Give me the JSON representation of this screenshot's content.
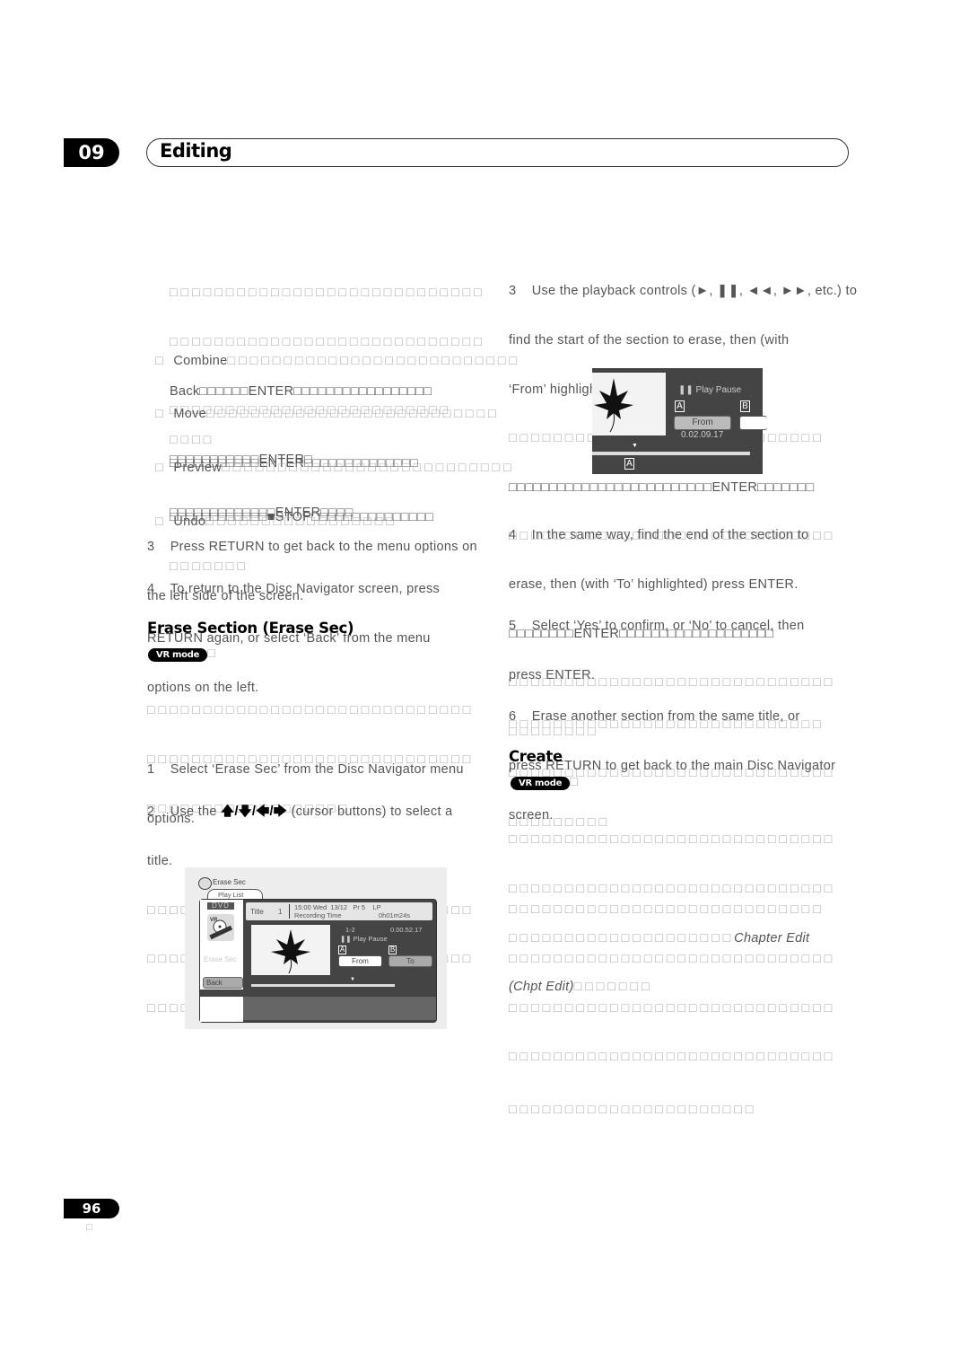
{
  "header": {
    "chapter_number": "09",
    "chapter_title": "Editing"
  },
  "left_column": {
    "intro_lines": [
      "□□□□□□□□□□□□□□□□□□□□□□□□□□□□",
      "□□□□□□□□□□□□□□□□□□□□□□□□□□□□",
      "Back□□□□□□ENTER□□□□□□□□□□□□□□□□□",
      "□□□□"
    ],
    "bullets": [
      {
        "label": "Combine",
        "lines": [
          "□□□□□□□□□□□□□□□□□□□□□□□□□□",
          "□□□□□□□□□□□□□□□□□□□□□□□□□",
          "□□□□□□□□□□□ENTER□"
        ]
      },
      {
        "label": "Move",
        "lines": [
          "□□□□□□□□□□□□□□□□□□□□□□□□□□",
          "□□□□□□□□□□□ENTER□□□□□□□□□□□□□□",
          "□□□□□□□□□□□□□ENTER□□□□"
        ]
      },
      {
        "label": "Preview",
        "lines": [
          "□□□□□□□□□□□□□□□□□□□□□□□□□□",
          "□□□□□□□□□□□□■STOP□□□□□□□□□□□□□□□",
          "□□□□□□□"
        ]
      },
      {
        "label": "Undo",
        "lines": [
          "□□□□□□□□□□□□□□□□□"
        ]
      }
    ],
    "step3": {
      "num": "3",
      "lines": [
        "Press RETURN to get back to the menu options on",
        "the left side of the screen."
      ]
    },
    "step4": {
      "num": "4",
      "lines": [
        "To return to the Disc Navigator screen, press",
        "RETURN again, or select ‘Back’ from the menu",
        "options on the left."
      ]
    },
    "erase_section": {
      "heading": "Erase Section (Erase Sec)",
      "badge": "VR mode",
      "badge_suffix": "□",
      "intro_lines": [
        "□□□□□□□□□□□□□□□□□□□□□□□□□□□□□",
        "□□□□□□□□□□□□□□□□□□□□□□□□□□□□□",
        "□□□□□□□□□□□□□□□□□□"
      ],
      "step1": {
        "num": "1",
        "lines": [
          "Select ‘Erase Sec’ from the Disc Navigator menu",
          "options."
        ]
      },
      "step2": {
        "num": "2",
        "text_before": "Use the",
        "arrows": "🡅/🡇/🡄/🡆",
        "text_after": "(cursor buttons) to select a",
        "line2": "title."
      },
      "step2_tofu": [
        "□□□□□□□□□□□□□□□□□□□□□□□□□□□□□",
        "□□□□□□□□□□□□□□□□□□□□□□□□□□□□□",
        "□□□□□□□□□□"
      ]
    }
  },
  "screen1": {
    "menu_title": "Erase Sec",
    "tab": "Play List",
    "disc_type": "DVD",
    "title_label": "Title",
    "title_number": "1",
    "datetime": "15:00 Wed  13/12   Pr 5    LP",
    "recording_time_label": "Recording Time",
    "recording_time": "0h01m24s",
    "chapter": "1-2",
    "timecode": "0.00.52.17",
    "status": "Play Pause",
    "marker_a": "A",
    "marker_b": "B",
    "from_button": "From",
    "to_button": "To",
    "side_label": "Erase Sec",
    "back_button": "Back"
  },
  "right_column": {
    "step3": {
      "num": "3",
      "lines": [
        "Use the playback controls (►, ❚❚, ◄◄, ►►, etc.) to",
        "find the start of the section to erase, then (with",
        "‘From’ highlighted) press ENTER."
      ]
    },
    "step3_tofu": [
      "□□□□□□□□□□□□□□□□□□□□□□□□□□□□",
      "□□□□□□□□□□□□□□□□□□□□□□□□□ENTER□□□□□□□",
      "□□□□□□□□□□□□□□□□□□□□□□□□□□□□□"
    ],
    "step4": {
      "num": "4",
      "lines": [
        "In the same way, find the end of the section to",
        "erase, then (with ‘To’ highlighted) press ENTER."
      ]
    },
    "step4_tofu": [
      "□□□□□□□□ENTER□□□□□□□□□□□□□□□□□□□",
      "□□□□□□□□□□□□□□□□□□□□□□□□□□□□□",
      "□□□□□□□□"
    ],
    "step5": {
      "num": "5",
      "lines": [
        "Select ‘Yes’ to confirm, or ‘No’ to cancel, then",
        "press ENTER."
      ]
    },
    "step5_tofu": [
      "□□□□□□□□□□□□□□□□□□□□□□□□□□□□",
      "□□□□□□□□□□□□□□□□□□□□□□□□□□□□□",
      "□□□□□□□□□"
    ],
    "step6": {
      "num": "6",
      "lines": [
        "Erase another section from the same title, or",
        "press RETURN to get back to the main Disc Navigator",
        "screen."
      ]
    },
    "create": {
      "heading": "Create",
      "badge": "VR mode",
      "badge_suffix": "□",
      "para1": [
        "□□□□□□□□□□□□□□□□□□□□□□□□□□□□□",
        "□□□□□□□□□□□□□□□□□□□□□□□□□□□□□"
      ],
      "para1_line3_tofu": "□□□□□□□□□□□□□□□□□□□□",
      "para1_line3_link": "Chapter Edit",
      "para1_line4_link": "(Chpt Edit)",
      "para1_line4_tofu": "□□□□□□□",
      "para2": [
        "□□□□□□□□□□□□□□□□□□□□□□□□□□□□",
        "□□□□□□□□□□□□□□□□□□□□□□□□□□□□□",
        "□□□□□□□□□□□□□□□□□□□□□□□□□□□□□",
        "□□□□□□□□□□□□□□□□□□□□□□□□□□□□□",
        "□□□□□□□□□□□□□□□□□□□□□□"
      ]
    }
  },
  "screen2": {
    "status": "Play Pause",
    "marker_a": "A",
    "marker_b": "B",
    "from_button": "From",
    "timecode": "0.02.09.17",
    "bar_marker": "A"
  },
  "footer": {
    "page_number": "96",
    "lang_mark": "□"
  }
}
